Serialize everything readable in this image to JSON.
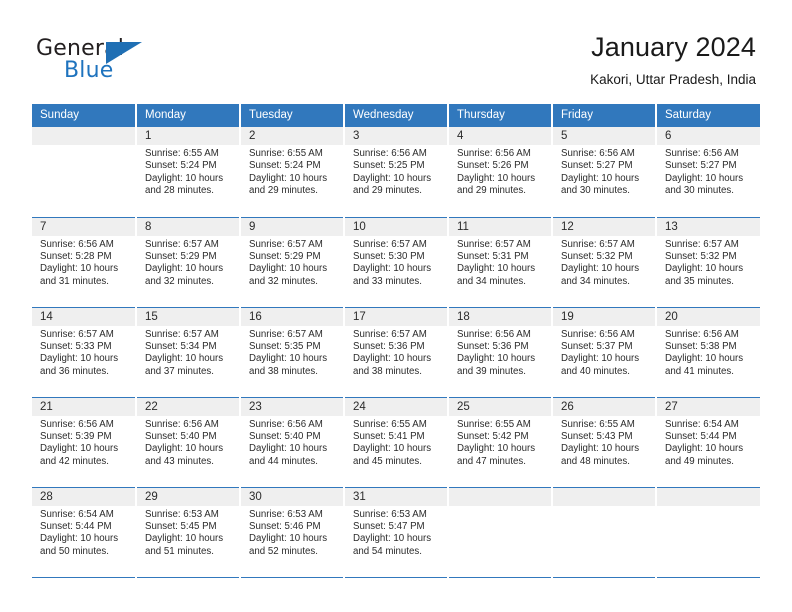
{
  "brand": {
    "name_part1": "General",
    "name_part2": "Blue",
    "triangle_color": "#1f6fb4",
    "blue_text_color": "#1e73be"
  },
  "header": {
    "title": "January 2024",
    "subtitle": "Kakori, Uttar Pradesh, India"
  },
  "theme": {
    "header_row_bg": "#3178bd",
    "daynum_bg": "#efefef",
    "row_separator": "#3178bd",
    "text_color": "#2b2b2b"
  },
  "weekday_headers": [
    "Sunday",
    "Monday",
    "Tuesday",
    "Wednesday",
    "Thursday",
    "Friday",
    "Saturday"
  ],
  "weeks": [
    [
      {
        "day": "",
        "sunrise": "",
        "sunset": "",
        "daylight_line1": "",
        "daylight_line2": ""
      },
      {
        "day": "1",
        "sunrise": "Sunrise: 6:55 AM",
        "sunset": "Sunset: 5:24 PM",
        "daylight_line1": "Daylight: 10 hours",
        "daylight_line2": "and 28 minutes."
      },
      {
        "day": "2",
        "sunrise": "Sunrise: 6:55 AM",
        "sunset": "Sunset: 5:24 PM",
        "daylight_line1": "Daylight: 10 hours",
        "daylight_line2": "and 29 minutes."
      },
      {
        "day": "3",
        "sunrise": "Sunrise: 6:56 AM",
        "sunset": "Sunset: 5:25 PM",
        "daylight_line1": "Daylight: 10 hours",
        "daylight_line2": "and 29 minutes."
      },
      {
        "day": "4",
        "sunrise": "Sunrise: 6:56 AM",
        "sunset": "Sunset: 5:26 PM",
        "daylight_line1": "Daylight: 10 hours",
        "daylight_line2": "and 29 minutes."
      },
      {
        "day": "5",
        "sunrise": "Sunrise: 6:56 AM",
        "sunset": "Sunset: 5:27 PM",
        "daylight_line1": "Daylight: 10 hours",
        "daylight_line2": "and 30 minutes."
      },
      {
        "day": "6",
        "sunrise": "Sunrise: 6:56 AM",
        "sunset": "Sunset: 5:27 PM",
        "daylight_line1": "Daylight: 10 hours",
        "daylight_line2": "and 30 minutes."
      }
    ],
    [
      {
        "day": "7",
        "sunrise": "Sunrise: 6:56 AM",
        "sunset": "Sunset: 5:28 PM",
        "daylight_line1": "Daylight: 10 hours",
        "daylight_line2": "and 31 minutes."
      },
      {
        "day": "8",
        "sunrise": "Sunrise: 6:57 AM",
        "sunset": "Sunset: 5:29 PM",
        "daylight_line1": "Daylight: 10 hours",
        "daylight_line2": "and 32 minutes."
      },
      {
        "day": "9",
        "sunrise": "Sunrise: 6:57 AM",
        "sunset": "Sunset: 5:29 PM",
        "daylight_line1": "Daylight: 10 hours",
        "daylight_line2": "and 32 minutes."
      },
      {
        "day": "10",
        "sunrise": "Sunrise: 6:57 AM",
        "sunset": "Sunset: 5:30 PM",
        "daylight_line1": "Daylight: 10 hours",
        "daylight_line2": "and 33 minutes."
      },
      {
        "day": "11",
        "sunrise": "Sunrise: 6:57 AM",
        "sunset": "Sunset: 5:31 PM",
        "daylight_line1": "Daylight: 10 hours",
        "daylight_line2": "and 34 minutes."
      },
      {
        "day": "12",
        "sunrise": "Sunrise: 6:57 AM",
        "sunset": "Sunset: 5:32 PM",
        "daylight_line1": "Daylight: 10 hours",
        "daylight_line2": "and 34 minutes."
      },
      {
        "day": "13",
        "sunrise": "Sunrise: 6:57 AM",
        "sunset": "Sunset: 5:32 PM",
        "daylight_line1": "Daylight: 10 hours",
        "daylight_line2": "and 35 minutes."
      }
    ],
    [
      {
        "day": "14",
        "sunrise": "Sunrise: 6:57 AM",
        "sunset": "Sunset: 5:33 PM",
        "daylight_line1": "Daylight: 10 hours",
        "daylight_line2": "and 36 minutes."
      },
      {
        "day": "15",
        "sunrise": "Sunrise: 6:57 AM",
        "sunset": "Sunset: 5:34 PM",
        "daylight_line1": "Daylight: 10 hours",
        "daylight_line2": "and 37 minutes."
      },
      {
        "day": "16",
        "sunrise": "Sunrise: 6:57 AM",
        "sunset": "Sunset: 5:35 PM",
        "daylight_line1": "Daylight: 10 hours",
        "daylight_line2": "and 38 minutes."
      },
      {
        "day": "17",
        "sunrise": "Sunrise: 6:57 AM",
        "sunset": "Sunset: 5:36 PM",
        "daylight_line1": "Daylight: 10 hours",
        "daylight_line2": "and 38 minutes."
      },
      {
        "day": "18",
        "sunrise": "Sunrise: 6:56 AM",
        "sunset": "Sunset: 5:36 PM",
        "daylight_line1": "Daylight: 10 hours",
        "daylight_line2": "and 39 minutes."
      },
      {
        "day": "19",
        "sunrise": "Sunrise: 6:56 AM",
        "sunset": "Sunset: 5:37 PM",
        "daylight_line1": "Daylight: 10 hours",
        "daylight_line2": "and 40 minutes."
      },
      {
        "day": "20",
        "sunrise": "Sunrise: 6:56 AM",
        "sunset": "Sunset: 5:38 PM",
        "daylight_line1": "Daylight: 10 hours",
        "daylight_line2": "and 41 minutes."
      }
    ],
    [
      {
        "day": "21",
        "sunrise": "Sunrise: 6:56 AM",
        "sunset": "Sunset: 5:39 PM",
        "daylight_line1": "Daylight: 10 hours",
        "daylight_line2": "and 42 minutes."
      },
      {
        "day": "22",
        "sunrise": "Sunrise: 6:56 AM",
        "sunset": "Sunset: 5:40 PM",
        "daylight_line1": "Daylight: 10 hours",
        "daylight_line2": "and 43 minutes."
      },
      {
        "day": "23",
        "sunrise": "Sunrise: 6:56 AM",
        "sunset": "Sunset: 5:40 PM",
        "daylight_line1": "Daylight: 10 hours",
        "daylight_line2": "and 44 minutes."
      },
      {
        "day": "24",
        "sunrise": "Sunrise: 6:55 AM",
        "sunset": "Sunset: 5:41 PM",
        "daylight_line1": "Daylight: 10 hours",
        "daylight_line2": "and 45 minutes."
      },
      {
        "day": "25",
        "sunrise": "Sunrise: 6:55 AM",
        "sunset": "Sunset: 5:42 PM",
        "daylight_line1": "Daylight: 10 hours",
        "daylight_line2": "and 47 minutes."
      },
      {
        "day": "26",
        "sunrise": "Sunrise: 6:55 AM",
        "sunset": "Sunset: 5:43 PM",
        "daylight_line1": "Daylight: 10 hours",
        "daylight_line2": "and 48 minutes."
      },
      {
        "day": "27",
        "sunrise": "Sunrise: 6:54 AM",
        "sunset": "Sunset: 5:44 PM",
        "daylight_line1": "Daylight: 10 hours",
        "daylight_line2": "and 49 minutes."
      }
    ],
    [
      {
        "day": "28",
        "sunrise": "Sunrise: 6:54 AM",
        "sunset": "Sunset: 5:44 PM",
        "daylight_line1": "Daylight: 10 hours",
        "daylight_line2": "and 50 minutes."
      },
      {
        "day": "29",
        "sunrise": "Sunrise: 6:53 AM",
        "sunset": "Sunset: 5:45 PM",
        "daylight_line1": "Daylight: 10 hours",
        "daylight_line2": "and 51 minutes."
      },
      {
        "day": "30",
        "sunrise": "Sunrise: 6:53 AM",
        "sunset": "Sunset: 5:46 PM",
        "daylight_line1": "Daylight: 10 hours",
        "daylight_line2": "and 52 minutes."
      },
      {
        "day": "31",
        "sunrise": "Sunrise: 6:53 AM",
        "sunset": "Sunset: 5:47 PM",
        "daylight_line1": "Daylight: 10 hours",
        "daylight_line2": "and 54 minutes."
      },
      {
        "day": "",
        "sunrise": "",
        "sunset": "",
        "daylight_line1": "",
        "daylight_line2": ""
      },
      {
        "day": "",
        "sunrise": "",
        "sunset": "",
        "daylight_line1": "",
        "daylight_line2": ""
      },
      {
        "day": "",
        "sunrise": "",
        "sunset": "",
        "daylight_line1": "",
        "daylight_line2": ""
      }
    ]
  ]
}
